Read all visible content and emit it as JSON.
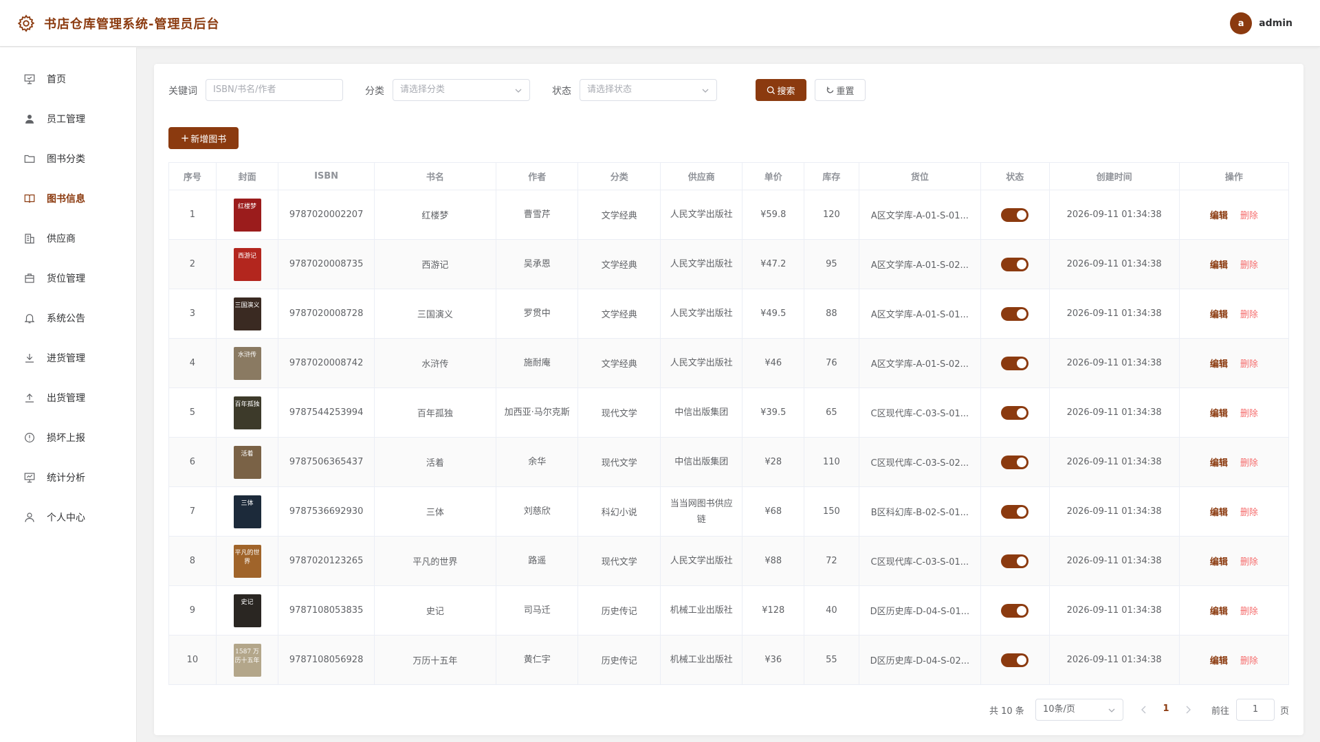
{
  "header": {
    "title": "书店仓库管理系统-管理员后台",
    "avatar_letter": "a",
    "username": "admin"
  },
  "sidebar": {
    "items": [
      {
        "label": "首页",
        "icon": "presentation-icon",
        "active": false
      },
      {
        "label": "员工管理",
        "icon": "user-filled-icon",
        "active": false
      },
      {
        "label": "图书分类",
        "icon": "folder-icon",
        "active": false
      },
      {
        "label": "图书信息",
        "icon": "book-open-icon",
        "active": true
      },
      {
        "label": "供应商",
        "icon": "building-icon",
        "active": false
      },
      {
        "label": "货位管理",
        "icon": "box-icon",
        "active": false
      },
      {
        "label": "系统公告",
        "icon": "bell-icon",
        "active": false
      },
      {
        "label": "进货管理",
        "icon": "download-icon",
        "active": false
      },
      {
        "label": "出货管理",
        "icon": "upload-icon",
        "active": false
      },
      {
        "label": "损坏上报",
        "icon": "warning-circle-icon",
        "active": false
      },
      {
        "label": "统计分析",
        "icon": "chart-board-icon",
        "active": false
      },
      {
        "label": "个人中心",
        "icon": "user-outline-icon",
        "active": false
      }
    ]
  },
  "search": {
    "keyword_label": "关键词",
    "keyword_placeholder": "ISBN/书名/作者",
    "category_label": "分类",
    "category_placeholder": "请选择分类",
    "status_label": "状态",
    "status_placeholder": "请选择状态",
    "search_button": "搜索",
    "reset_button": "重置"
  },
  "toolbar": {
    "add_button": "新增图书"
  },
  "table": {
    "columns": [
      "序号",
      "封面",
      "ISBN",
      "书名",
      "作者",
      "分类",
      "供应商",
      "单价",
      "库存",
      "货位",
      "状态",
      "创建时间",
      "操作"
    ],
    "edit_label": "编辑",
    "delete_label": "删除",
    "rows": [
      {
        "index": "1",
        "cover_text": "红楼梦",
        "cover_color": "#9b1c1c",
        "isbn": "9787020002207",
        "title": "红楼梦",
        "author": "曹雪芹",
        "category": "文学经典",
        "supplier": "人民文学出版社",
        "price": "¥59.8",
        "stock": "120",
        "location": "A区文学库-A-01-S-01...",
        "status": true,
        "created": "2026-09-11 01:34:38"
      },
      {
        "index": "2",
        "cover_text": "西游记",
        "cover_color": "#b3261e",
        "isbn": "9787020008735",
        "title": "西游记",
        "author": "吴承恩",
        "category": "文学经典",
        "supplier": "人民文学出版社",
        "price": "¥47.2",
        "stock": "95",
        "location": "A区文学库-A-01-S-02...",
        "status": true,
        "created": "2026-09-11 01:34:38"
      },
      {
        "index": "3",
        "cover_text": "三国演义",
        "cover_color": "#3a2a22",
        "isbn": "9787020008728",
        "title": "三国演义",
        "author": "罗贯中",
        "category": "文学经典",
        "supplier": "人民文学出版社",
        "price": "¥49.5",
        "stock": "88",
        "location": "A区文学库-A-01-S-01...",
        "status": true,
        "created": "2026-09-11 01:34:38"
      },
      {
        "index": "4",
        "cover_text": "水浒传",
        "cover_color": "#8a7a62",
        "isbn": "9787020008742",
        "title": "水浒传",
        "author": "施耐庵",
        "category": "文学经典",
        "supplier": "人民文学出版社",
        "price": "¥46",
        "stock": "76",
        "location": "A区文学库-A-01-S-02...",
        "status": true,
        "created": "2026-09-11 01:34:38"
      },
      {
        "index": "5",
        "cover_text": "百年孤独",
        "cover_color": "#3d3a2a",
        "isbn": "9787544253994",
        "title": "百年孤独",
        "author": "加西亚·马尔克斯",
        "category": "现代文学",
        "supplier": "中信出版集团",
        "price": "¥39.5",
        "stock": "65",
        "location": "C区现代库-C-03-S-01...",
        "status": true,
        "created": "2026-09-11 01:34:38"
      },
      {
        "index": "6",
        "cover_text": "活着",
        "cover_color": "#7a6246",
        "isbn": "9787506365437",
        "title": "活着",
        "author": "余华",
        "category": "现代文学",
        "supplier": "中信出版集团",
        "price": "¥28",
        "stock": "110",
        "location": "C区现代库-C-03-S-02...",
        "status": true,
        "created": "2026-09-11 01:34:38"
      },
      {
        "index": "7",
        "cover_text": "三体",
        "cover_color": "#1c2a3a",
        "isbn": "9787536692930",
        "title": "三体",
        "author": "刘慈欣",
        "category": "科幻小说",
        "supplier": "当当网图书供应链",
        "price": "¥68",
        "stock": "150",
        "location": "B区科幻库-B-02-S-01...",
        "status": true,
        "created": "2026-09-11 01:34:38"
      },
      {
        "index": "8",
        "cover_text": "平凡的世界",
        "cover_color": "#a0642a",
        "isbn": "9787020123265",
        "title": "平凡的世界",
        "author": "路遥",
        "category": "现代文学",
        "supplier": "人民文学出版社",
        "price": "¥88",
        "stock": "72",
        "location": "C区现代库-C-03-S-01...",
        "status": true,
        "created": "2026-09-11 01:34:38"
      },
      {
        "index": "9",
        "cover_text": "史记",
        "cover_color": "#2a2622",
        "isbn": "9787108053835",
        "title": "史记",
        "author": "司马迁",
        "category": "历史传记",
        "supplier": "机械工业出版社",
        "price": "¥128",
        "stock": "40",
        "location": "D区历史库-D-04-S-01...",
        "status": true,
        "created": "2026-09-11 01:34:38"
      },
      {
        "index": "10",
        "cover_text": "1587 万历十五年",
        "cover_color": "#b3a68a",
        "isbn": "9787108056928",
        "title": "万历十五年",
        "author": "黄仁宇",
        "category": "历史传记",
        "supplier": "机械工业出版社",
        "price": "¥36",
        "stock": "55",
        "location": "D区历史库-D-04-S-02...",
        "status": true,
        "created": "2026-09-11 01:34:38"
      }
    ]
  },
  "pagination": {
    "total_text": "共 10 条",
    "page_size": "10条/页",
    "current_page": "1",
    "goto_label": "前往",
    "goto_value": "1",
    "page_suffix": "页"
  },
  "colors": {
    "accent": "#8b3a0f",
    "danger": "#f56c6c"
  }
}
